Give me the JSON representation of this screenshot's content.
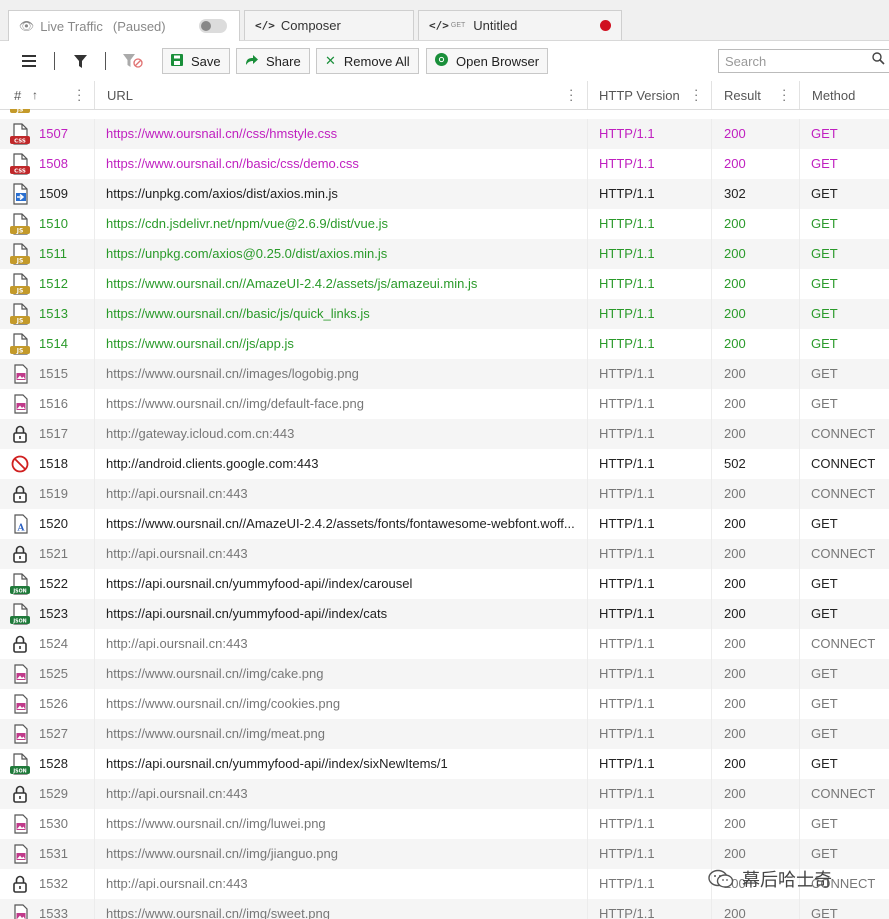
{
  "tabs": {
    "live": {
      "label": "Live Traffic",
      "status": "(Paused)"
    },
    "composer": {
      "label": "Composer"
    },
    "untitled": {
      "method": "GET",
      "label": "Untitled"
    }
  },
  "toolbar": {
    "save_label": "Save",
    "share_label": "Share",
    "remove_all_label": "Remove All",
    "open_browser_label": "Open Browser",
    "search_placeholder": "Search"
  },
  "columns": {
    "num": "#",
    "url": "URL",
    "version": "HTTP Version",
    "result": "Result",
    "method": "Method"
  },
  "colors": {
    "css": "#c020c0",
    "js": "#2a9a2a",
    "normal": "#222222",
    "muted": "#777777"
  },
  "rows": [
    {
      "num": "1507",
      "url": "https://www.oursnail.cn//css/hmstyle.css",
      "version": "HTTP/1.1",
      "result": "200",
      "method": "GET",
      "icon": "css",
      "color": "#c020c0"
    },
    {
      "num": "1508",
      "url": "https://www.oursnail.cn//basic/css/demo.css",
      "version": "HTTP/1.1",
      "result": "200",
      "method": "GET",
      "icon": "css",
      "color": "#c020c0"
    },
    {
      "num": "1509",
      "url": "https://unpkg.com/axios/dist/axios.min.js",
      "version": "HTTP/1.1",
      "result": "302",
      "method": "GET",
      "icon": "redirect",
      "color": "#222222"
    },
    {
      "num": "1510",
      "url": "https://cdn.jsdelivr.net/npm/vue@2.6.9/dist/vue.js",
      "version": "HTTP/1.1",
      "result": "200",
      "method": "GET",
      "icon": "js",
      "color": "#2a9a2a"
    },
    {
      "num": "1511",
      "url": "https://unpkg.com/axios@0.25.0/dist/axios.min.js",
      "version": "HTTP/1.1",
      "result": "200",
      "method": "GET",
      "icon": "js",
      "color": "#2a9a2a"
    },
    {
      "num": "1512",
      "url": "https://www.oursnail.cn//AmazeUI-2.4.2/assets/js/amazeui.min.js",
      "version": "HTTP/1.1",
      "result": "200",
      "method": "GET",
      "icon": "js",
      "color": "#2a9a2a"
    },
    {
      "num": "1513",
      "url": "https://www.oursnail.cn//basic/js/quick_links.js",
      "version": "HTTP/1.1",
      "result": "200",
      "method": "GET",
      "icon": "js",
      "color": "#2a9a2a"
    },
    {
      "num": "1514",
      "url": "https://www.oursnail.cn//js/app.js",
      "version": "HTTP/1.1",
      "result": "200",
      "method": "GET",
      "icon": "js",
      "color": "#2a9a2a"
    },
    {
      "num": "1515",
      "url": "https://www.oursnail.cn//images/logobig.png",
      "version": "HTTP/1.1",
      "result": "200",
      "method": "GET",
      "icon": "image",
      "color": "#777777"
    },
    {
      "num": "1516",
      "url": "https://www.oursnail.cn//img/default-face.png",
      "version": "HTTP/1.1",
      "result": "200",
      "method": "GET",
      "icon": "image",
      "color": "#777777"
    },
    {
      "num": "1517",
      "url": "http://gateway.icloud.com.cn:443",
      "version": "HTTP/1.1",
      "result": "200",
      "method": "CONNECT",
      "icon": "lock",
      "color": "#777777"
    },
    {
      "num": "1518",
      "url": "http://android.clients.google.com:443",
      "version": "HTTP/1.1",
      "result": "502",
      "method": "CONNECT",
      "icon": "blocked",
      "color": "#222222"
    },
    {
      "num": "1519",
      "url": "http://api.oursnail.cn:443",
      "version": "HTTP/1.1",
      "result": "200",
      "method": "CONNECT",
      "icon": "lock",
      "color": "#777777"
    },
    {
      "num": "1520",
      "url": "https://www.oursnail.cn//AmazeUI-2.4.2/assets/fonts/fontawesome-webfont.woff...",
      "version": "HTTP/1.1",
      "result": "200",
      "method": "GET",
      "icon": "font",
      "color": "#222222"
    },
    {
      "num": "1521",
      "url": "http://api.oursnail.cn:443",
      "version": "HTTP/1.1",
      "result": "200",
      "method": "CONNECT",
      "icon": "lock",
      "color": "#777777"
    },
    {
      "num": "1522",
      "url": "https://api.oursnail.cn/yummyfood-api//index/carousel",
      "version": "HTTP/1.1",
      "result": "200",
      "method": "GET",
      "icon": "json",
      "color": "#222222"
    },
    {
      "num": "1523",
      "url": "https://api.oursnail.cn/yummyfood-api//index/cats",
      "version": "HTTP/1.1",
      "result": "200",
      "method": "GET",
      "icon": "json",
      "color": "#222222"
    },
    {
      "num": "1524",
      "url": "http://api.oursnail.cn:443",
      "version": "HTTP/1.1",
      "result": "200",
      "method": "CONNECT",
      "icon": "lock",
      "color": "#777777"
    },
    {
      "num": "1525",
      "url": "https://www.oursnail.cn//img/cake.png",
      "version": "HTTP/1.1",
      "result": "200",
      "method": "GET",
      "icon": "image",
      "color": "#777777"
    },
    {
      "num": "1526",
      "url": "https://www.oursnail.cn//img/cookies.png",
      "version": "HTTP/1.1",
      "result": "200",
      "method": "GET",
      "icon": "image",
      "color": "#777777"
    },
    {
      "num": "1527",
      "url": "https://www.oursnail.cn//img/meat.png",
      "version": "HTTP/1.1",
      "result": "200",
      "method": "GET",
      "icon": "image",
      "color": "#777777"
    },
    {
      "num": "1528",
      "url": "https://api.oursnail.cn/yummyfood-api//index/sixNewItems/1",
      "version": "HTTP/1.1",
      "result": "200",
      "method": "GET",
      "icon": "json",
      "color": "#222222"
    },
    {
      "num": "1529",
      "url": "http://api.oursnail.cn:443",
      "version": "HTTP/1.1",
      "result": "200",
      "method": "CONNECT",
      "icon": "lock",
      "color": "#777777"
    },
    {
      "num": "1530",
      "url": "https://www.oursnail.cn//img/luwei.png",
      "version": "HTTP/1.1",
      "result": "200",
      "method": "GET",
      "icon": "image",
      "color": "#777777"
    },
    {
      "num": "1531",
      "url": "https://www.oursnail.cn//img/jianguo.png",
      "version": "HTTP/1.1",
      "result": "200",
      "method": "GET",
      "icon": "image",
      "color": "#777777"
    },
    {
      "num": "1532",
      "url": "http://api.oursnail.cn:443",
      "version": "HTTP/1.1",
      "result": "200",
      "method": "CONNECT",
      "icon": "lock",
      "color": "#777777"
    },
    {
      "num": "1533",
      "url": "https://www.oursnail.cn//img/sweet.png",
      "version": "HTTP/1.1",
      "result": "200",
      "method": "GET",
      "icon": "image",
      "color": "#777777"
    }
  ],
  "watermark": {
    "text": "幕后哈士奇"
  }
}
